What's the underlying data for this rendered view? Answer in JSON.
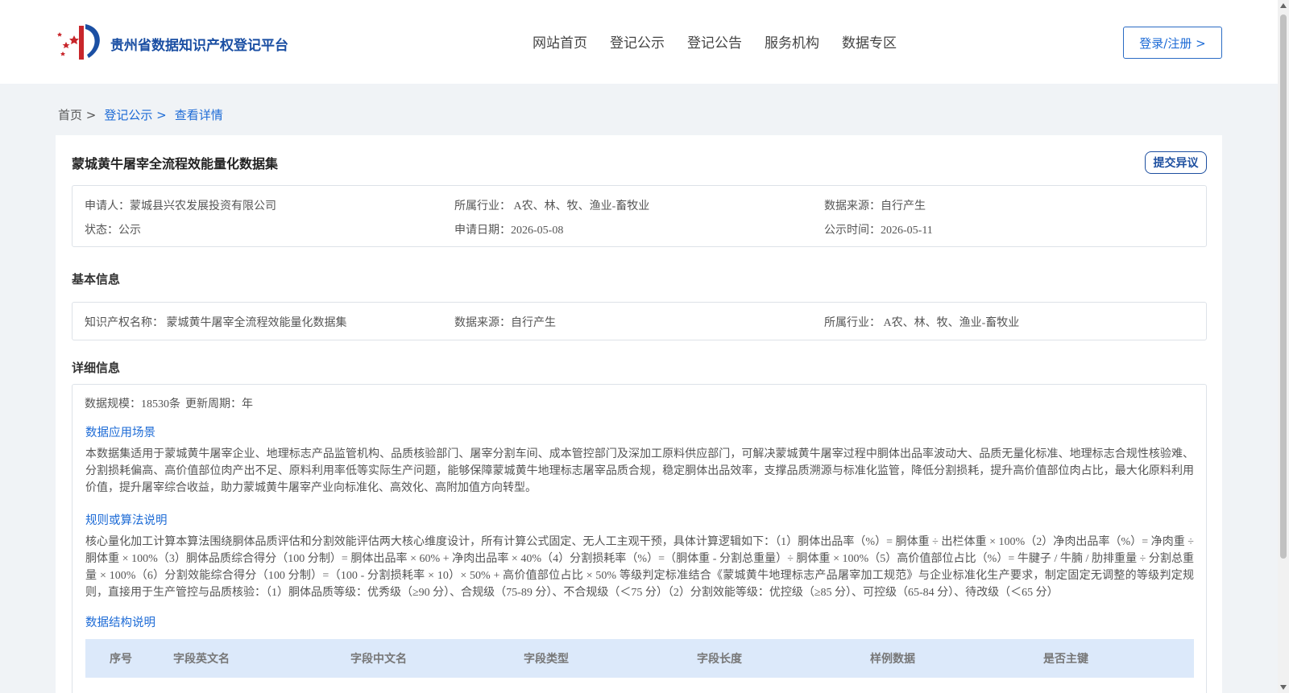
{
  "header": {
    "site_title": "贵州省数据知识产权登记平台",
    "nav": [
      "网站首页",
      "登记公示",
      "登记公告",
      "服务机构",
      "数据专区"
    ],
    "login_label": "登录/注册 >"
  },
  "breadcrumb": {
    "home": "首页 >",
    "items": [
      "登记公示 >",
      "查看详情"
    ]
  },
  "detail": {
    "title": "蒙城黄牛屠宰全流程效能量化数据集",
    "objection_label": "提交异议",
    "summary": {
      "applicant": "申请人：蒙城县兴农发展投资有限公司",
      "industry": "所属行业： A农、林、牧、渔业-畜牧业",
      "source": "数据来源：自行产生",
      "status": "状态：公示",
      "apply_date": "申请日期：2026-05-08",
      "publish_date": "公示时间：2026-05-11"
    },
    "basic_label": "基本信息",
    "basic": {
      "ip_name": "知识产权名称： 蒙城黄牛屠宰全流程效能量化数据集",
      "source": "数据来源：自行产生",
      "industry": "所属行业： A农、林、牧、渔业-畜牧业"
    },
    "detail_label": "详细信息",
    "scale": "数据规模：18530条",
    "cycle": "更新周期：年",
    "scenario_heading": "数据应用场景",
    "scenario_text": "本数据集适用于蒙城黄牛屠宰企业、地理标志产品监管机构、品质核验部门、屠宰分割车间、成本管控部门及深加工原料供应部门，可解决蒙城黄牛屠宰过程中胴体出品率波动大、品质无量化标准、地理标志合规性核验难、分割损耗偏高、高价值部位肉产出不足、原料利用率低等实际生产问题，能够保障蒙城黄牛地理标志屠宰品质合规，稳定胴体出品效率，支撑品质溯源与标准化监管，降低分割损耗，提升高价值部位肉占比，最大化原料利用价值，提升屠宰综合收益，助力蒙城黄牛屠宰产业向标准化、高效化、高附加值方向转型。",
    "rules_heading": "规则或算法说明",
    "rules_text": "核心量化加工计算本算法围绕胴体品质评估和分割效能评估两大核心维度设计，所有计算公式固定、无人工主观干预，具体计算逻辑如下：（1）胴体出品率（%）= 胴体重 ÷ 出栏体重 × 100%（2）净肉出品率（%）= 净肉重 ÷ 胴体重 × 100%（3）胴体品质综合得分（100 分制）= 胴体出品率 × 60% + 净肉出品率 × 40%（4）分割损耗率（%）=（胴体重 - 分割总重量）÷ 胴体重 × 100%（5）高价值部位占比（%）= 牛腱子 / 牛腩 / 肋排重量 ÷ 分割总重量 × 100%（6）分割效能综合得分（100 分制）=（100 - 分割损耗率 × 10）× 50% + 高价值部位占比 × 50% 等级判定标准结合《蒙城黄牛地理标志产品屠宰加工规范》与企业标准化生产要求，制定固定无调整的等级判定规则，直接用于生产管控与品质核验：（1）胴体品质等级：优秀级（≥90 分）、合规级（75-89 分）、不合规级（＜75 分）（2）分割效能等级：优控级（≥85 分）、可控级（65-84 分）、待改级（＜65 分）",
    "structure_heading": "数据结构说明",
    "table_headers": [
      "序号",
      "字段英文名",
      "字段中文名",
      "字段类型",
      "字段长度",
      "样例数据",
      "是否主键"
    ]
  },
  "colors": {
    "brand_blue": "#1b4fa3",
    "link_blue": "#1d6bd6",
    "table_head_bg": "#dce9fa"
  }
}
